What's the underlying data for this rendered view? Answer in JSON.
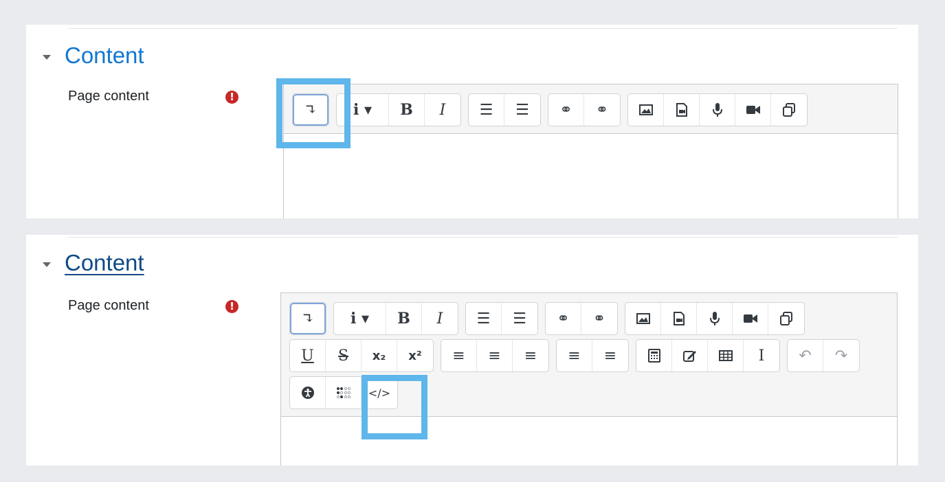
{
  "panels": [
    {
      "section_title": "Content",
      "field_label": "Page content",
      "required_icon": "!",
      "toolbar_rows": [
        [
          [
            {
              "icon": "toolbar-toggle-icon",
              "glyph": "↴"
            }
          ],
          [
            {
              "icon": "paragraph-styles-icon",
              "glyph": "i ▾"
            },
            {
              "icon": "bold-icon",
              "glyph": "B"
            },
            {
              "icon": "italic-icon",
              "glyph": "I"
            }
          ],
          [
            {
              "icon": "unordered-list-icon",
              "glyph": "☰"
            },
            {
              "icon": "ordered-list-icon",
              "glyph": "☰"
            }
          ],
          [
            {
              "icon": "link-icon",
              "glyph": "⚭"
            },
            {
              "icon": "unlink-icon",
              "glyph": "⚭"
            }
          ],
          [
            {
              "icon": "image-icon",
              "glyph": ""
            },
            {
              "icon": "media-icon",
              "glyph": ""
            },
            {
              "icon": "record-audio-icon",
              "glyph": ""
            },
            {
              "icon": "record-video-icon",
              "glyph": ""
            },
            {
              "icon": "manage-files-icon",
              "glyph": ""
            }
          ]
        ]
      ]
    },
    {
      "section_title": "Content",
      "field_label": "Page content",
      "required_icon": "!",
      "toolbar_rows": [
        [
          [
            {
              "icon": "toolbar-toggle-icon",
              "glyph": "↴"
            }
          ],
          [
            {
              "icon": "paragraph-styles-icon",
              "glyph": "i ▾"
            },
            {
              "icon": "bold-icon",
              "glyph": "B"
            },
            {
              "icon": "italic-icon",
              "glyph": "I"
            }
          ],
          [
            {
              "icon": "unordered-list-icon",
              "glyph": "☰"
            },
            {
              "icon": "ordered-list-icon",
              "glyph": "☰"
            }
          ],
          [
            {
              "icon": "link-icon",
              "glyph": "⚭"
            },
            {
              "icon": "unlink-icon",
              "glyph": "⚭"
            }
          ],
          [
            {
              "icon": "image-icon",
              "glyph": ""
            },
            {
              "icon": "media-icon",
              "glyph": ""
            },
            {
              "icon": "record-audio-icon",
              "glyph": ""
            },
            {
              "icon": "record-video-icon",
              "glyph": ""
            },
            {
              "icon": "manage-files-icon",
              "glyph": ""
            }
          ]
        ],
        [
          [
            {
              "icon": "underline-icon",
              "glyph": "U"
            },
            {
              "icon": "strikethrough-icon",
              "glyph": "S"
            },
            {
              "icon": "subscript-icon",
              "glyph": "x₂"
            },
            {
              "icon": "superscript-icon",
              "glyph": "x²"
            }
          ],
          [
            {
              "icon": "align-left-icon",
              "glyph": "≡"
            },
            {
              "icon": "align-center-icon",
              "glyph": "≡"
            },
            {
              "icon": "align-right-icon",
              "glyph": "≡"
            }
          ],
          [
            {
              "icon": "outdent-icon",
              "glyph": "≡"
            },
            {
              "icon": "indent-icon",
              "glyph": "≡"
            }
          ],
          [
            {
              "icon": "equation-icon",
              "glyph": ""
            },
            {
              "icon": "special-character-icon",
              "glyph": ""
            },
            {
              "icon": "table-icon",
              "glyph": ""
            },
            {
              "icon": "clear-formatting-icon",
              "glyph": "I"
            }
          ],
          [
            {
              "icon": "undo-icon",
              "glyph": "↶"
            },
            {
              "icon": "redo-icon",
              "glyph": "↷"
            }
          ]
        ],
        [
          [
            {
              "icon": "accessibility-checker-icon",
              "glyph": ""
            },
            {
              "icon": "screenreader-helper-icon",
              "glyph": ""
            },
            {
              "icon": "html-source-icon",
              "glyph": "</>"
            }
          ]
        ]
      ]
    }
  ],
  "colors": {
    "accent": "#1177d1",
    "highlight": "#5eb6ea",
    "required": "#c62828"
  }
}
